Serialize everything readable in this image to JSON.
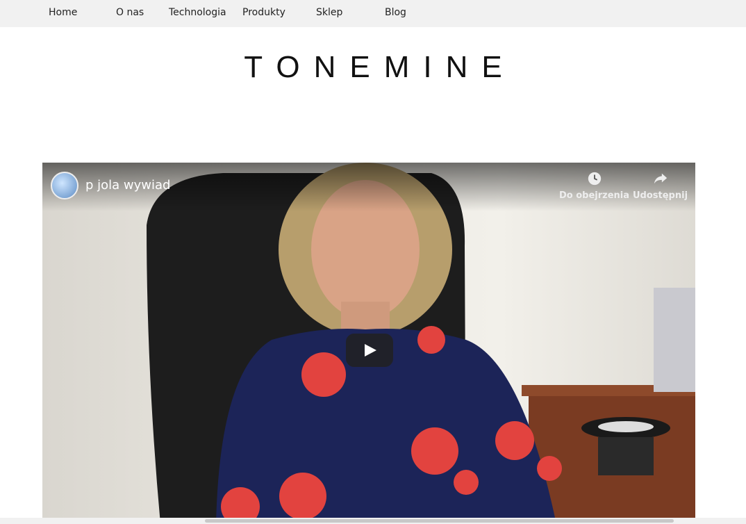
{
  "nav": {
    "items": [
      {
        "label": "Home"
      },
      {
        "label": "O nas"
      },
      {
        "label": "Technologia"
      },
      {
        "label": "Produkty"
      },
      {
        "label": "Sklep"
      },
      {
        "label": "Blog"
      }
    ]
  },
  "brand": {
    "logo_text": "TONEMINE"
  },
  "video": {
    "title": "p jola wywiad",
    "watch_later_label": "Do obejrzenia",
    "share_label": "Udostępnij",
    "channel_icon": "dice-avatar-icon",
    "play_icon": "play-icon",
    "watch_later_icon": "clock-icon",
    "share_icon": "share-arrow-icon"
  },
  "colors": {
    "nav_bg": "#f1f1f1",
    "play_button": "#212121",
    "dress": "#1c2458",
    "roses": "#e2433f"
  }
}
